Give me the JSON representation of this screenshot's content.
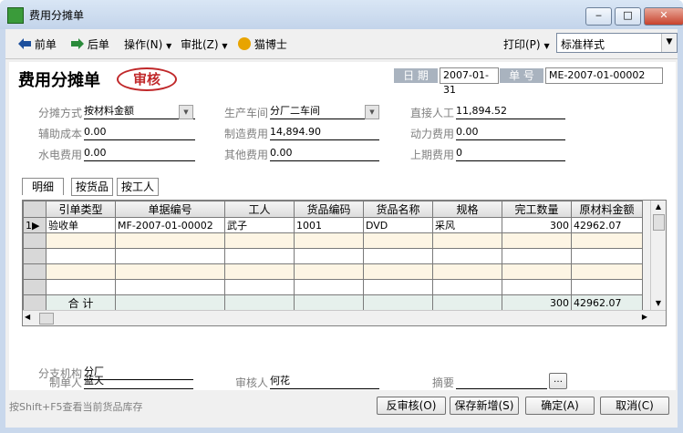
{
  "window": {
    "title": "费用分摊单",
    "minimize": "‒",
    "maximize": "□",
    "close": "✕"
  },
  "toolbar": {
    "prev": "前单",
    "next": "后单",
    "operate": "操作(N)",
    "approve": "审批(Z)",
    "assistant": "猫博士",
    "print": "打印(P)",
    "style_value": "标准样式"
  },
  "doc": {
    "title": "费用分摊单",
    "stamp": "审核",
    "date_label": "日 期",
    "date_value": "2007-01-31",
    "no_label": "单 号",
    "no_value": "ME-2007-01-00002"
  },
  "fields": {
    "alloc_method_label": "分摊方式",
    "alloc_method_value": "按材料金额",
    "workshop_label": "生产车间",
    "workshop_value": "分厂二车间",
    "direct_labor_label": "直接人工",
    "direct_labor_value": "11,894.52",
    "aux_cost_label": "辅助成本",
    "aux_cost_value": "0.00",
    "mfg_cost_label": "制造费用",
    "mfg_cost_value": "14,894.90",
    "power_cost_label": "动力费用",
    "power_cost_value": "0.00",
    "utility_label": "水电费用",
    "utility_value": "0.00",
    "other_cost_label": "其他费用",
    "other_cost_value": "0.00",
    "last_period_label": "上期费用",
    "last_period_value": "0"
  },
  "tabs": [
    "明细",
    "按货品",
    "按工人"
  ],
  "grid": {
    "columns": [
      "引单类型",
      "单据编号",
      "工人",
      "货品编码",
      "货品名称",
      "规格",
      "完工数量",
      "原材料金额"
    ],
    "rows": [
      {
        "idx": "1",
        "cells": [
          "验收单",
          "MF-2007-01-00002",
          "武子",
          "1001",
          "DVD",
          "采风",
          "300",
          "42962.07"
        ]
      }
    ],
    "total": {
      "label": "合  计",
      "qty": "300",
      "amount": "42962.07"
    }
  },
  "footer": {
    "maker_label": "制单人",
    "maker_value": "蓝天",
    "reviewer_label": "审核人",
    "reviewer_value": "何花",
    "summary_label": "摘要",
    "summary_value": "",
    "branch_label": "分支机构",
    "branch_value": "分厂",
    "browse": "…"
  },
  "bottom": {
    "hint": "按Shift+F5查看当前货品库存",
    "unapprove": "反审核(O)",
    "save_new": "保存新增(S)",
    "ok": "确定(A)",
    "cancel": "取消(C)"
  }
}
